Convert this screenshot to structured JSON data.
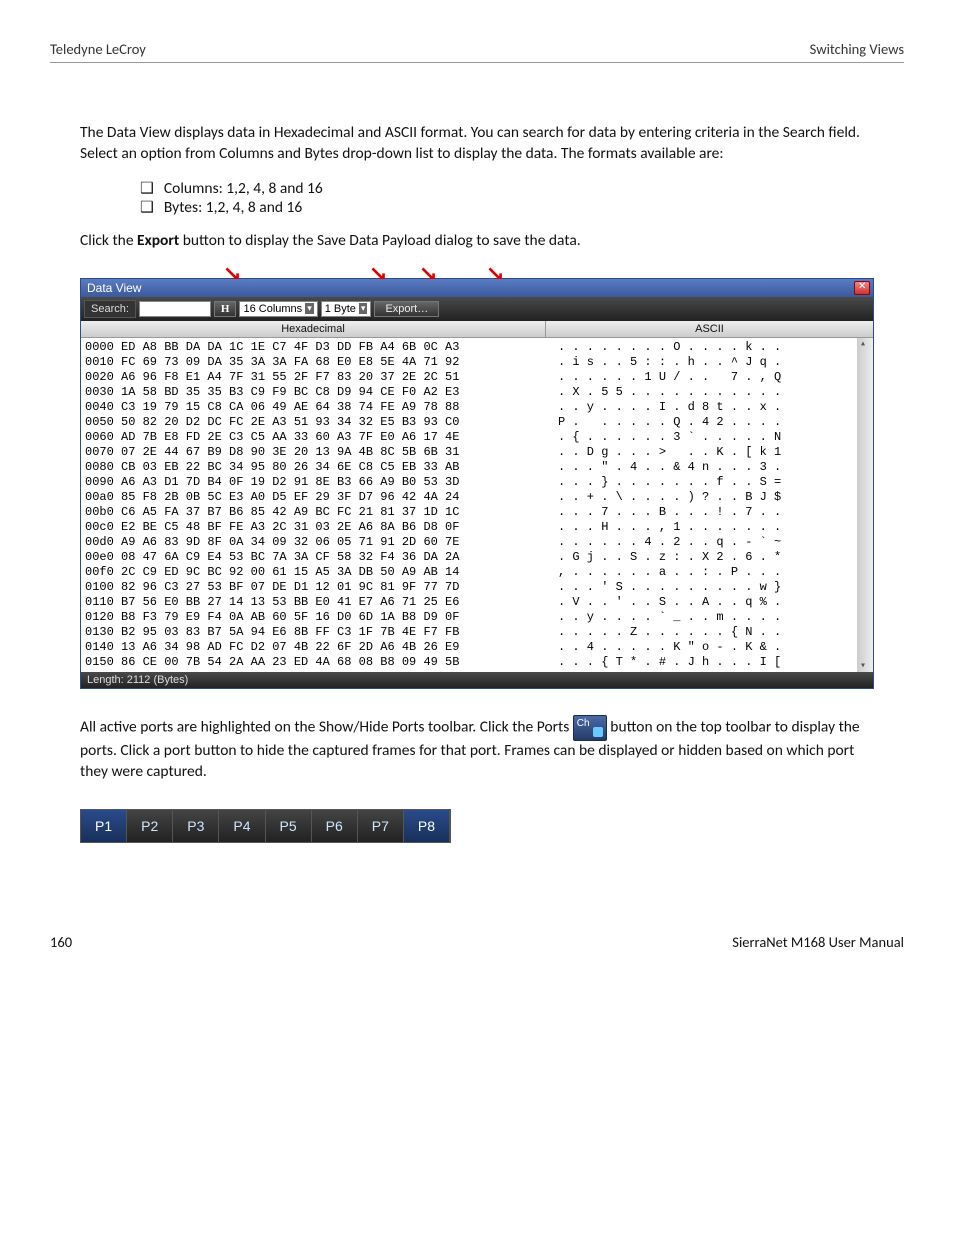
{
  "header": {
    "left": "Teledyne LeCroy",
    "right": "Switching Views"
  },
  "intro": {
    "p1": "The Data View displays data in Hexadecimal and ASCII format. You can search for data by entering criteria in the Search field. Select an option from Columns and Bytes drop-down list to display the data. The formats available are:",
    "li1": "Columns: 1,2, 4, 8 and 16",
    "li2": "Bytes: 1,2, 4, 8 and 16",
    "p2a": "Click the ",
    "p2b": "Export",
    "p2c": " button to display the Save Data Payload dialog to save the data."
  },
  "dv": {
    "title": "Data View",
    "search_label": "Search:",
    "h_button": "H",
    "col_dd": "16 Columns",
    "byte_dd": "1 Byte",
    "export_btn": "Export…",
    "col_hex": "Hexadecimal",
    "col_asc": "ASCII",
    "status": "Length: 2112 (Bytes)",
    "rows": [
      {
        "o": "0000",
        "h": "ED A8 BB DA DA 1C 1E C7 4F D3 DD FB A4 6B 0C A3",
        "a": ". . . . . . . . O . . . . k . ."
      },
      {
        "o": "0010",
        "h": "FC 69 73 09 DA 35 3A 3A FA 68 E0 E8 5E 4A 71 92",
        "a": ". i s . . 5 : : . h . . ^ J q ."
      },
      {
        "o": "0020",
        "h": "A6 96 F8 E1 A4 7F 31 55 2F F7 83 20 37 2E 2C 51",
        "a": ". . . . . . 1 U / . .   7 . , Q"
      },
      {
        "o": "0030",
        "h": "1A 58 BD 35 35 B3 C9 F9 BC C8 D9 94 CE F0 A2 E3",
        "a": ". X . 5 5 . . . . . . . . . . ."
      },
      {
        "o": "0040",
        "h": "C3 19 79 15 C8 CA 06 49 AE 64 38 74 FE A9 78 88",
        "a": ". . y . . . . I . d 8 t . . x ."
      },
      {
        "o": "0050",
        "h": "50 82 20 D2 DC FC 2E A3 51 93 34 32 E5 B3 93 C0",
        "a": "P .   . . . . . Q . 4 2 . . . ."
      },
      {
        "o": "0060",
        "h": "AD 7B E8 FD 2E C3 C5 AA 33 60 A3 7F E0 A6 17 4E",
        "a": ". { . . . . . . 3 ` . . . . . N"
      },
      {
        "o": "0070",
        "h": "07 2E 44 67 B9 D8 90 3E 20 13 9A 4B 8C 5B 6B 31",
        "a": ". . D g . . . >   . . K . [ k 1"
      },
      {
        "o": "0080",
        "h": "CB 03 EB 22 BC 34 95 80 26 34 6E C8 C5 EB 33 AB",
        "a": ". . . \" . 4 . . & 4 n . . . 3 ."
      },
      {
        "o": "0090",
        "h": "A6 A3 D1 7D B4 0F 19 D2 91 8E B3 66 A9 B0 53 3D",
        "a": ". . . } . . . . . . . f . . S ="
      },
      {
        "o": "00a0",
        "h": "85 F8 2B 0B 5C E3 A0 D5 EF 29 3F D7 96 42 4A 24",
        "a": ". . + . \\ . . . . ) ? . . B J $"
      },
      {
        "o": "00b0",
        "h": "C6 A5 FA 37 B7 B6 85 42 A9 BC FC 21 81 37 1D 1C",
        "a": ". . . 7 . . . B . . . ! . 7 . ."
      },
      {
        "o": "00c0",
        "h": "E2 BE C5 48 BF FE A3 2C 31 03 2E A6 8A B6 D8 0F",
        "a": ". . . H . . . , 1 . . . . . . ."
      },
      {
        "o": "00d0",
        "h": "A9 A6 83 9D 8F 0A 34 09 32 06 05 71 91 2D 60 7E",
        "a": ". . . . . . 4 . 2 . . q . - ` ~"
      },
      {
        "o": "00e0",
        "h": "08 47 6A C9 E4 53 BC 7A 3A CF 58 32 F4 36 DA 2A",
        "a": ". G j . . S . z : . X 2 . 6 . *"
      },
      {
        "o": "00f0",
        "h": "2C C9 ED 9C BC 92 00 61 15 A5 3A DB 50 A9 AB 14",
        "a": ", . . . . . . a . . : . P . . ."
      },
      {
        "o": "0100",
        "h": "82 96 C3 27 53 BF 07 DE D1 12 01 9C 81 9F 77 7D",
        "a": ". . . ' S . . . . . . . . . w }"
      },
      {
        "o": "0110",
        "h": "B7 56 E0 BB 27 14 13 53 BB E0 41 E7 A6 71 25 E6",
        "a": ". V . . ' . . S . . A . . q % ."
      },
      {
        "o": "0120",
        "h": "B8 F3 79 E9 F4 0A AB 60 5F 16 D0 6D 1A B8 D9 0F",
        "a": ". . y . . . . ` _ . . m . . . ."
      },
      {
        "o": "0130",
        "h": "B2 95 03 83 B7 5A 94 E6 8B FF C3 1F 7B 4E F7 FB",
        "a": ". . . . . Z . . . . . . { N . ."
      },
      {
        "o": "0140",
        "h": "13 A6 34 98 AD FC D2 07 4B 22 6F 2D A6 4B 26 E9",
        "a": ". . 4 . . . . . K \" o - . K & ."
      },
      {
        "o": "0150",
        "h": "86 CE 00 7B 54 2A AA 23 ED 4A 68 08 B8 09 49 5B",
        "a": ". . . { T * . # . J h . . . I ["
      }
    ]
  },
  "p3a": "All active ports are highlighted on the Show/Hide Ports toolbar. Click the Ports ",
  "p3b": " button on the top toolbar to display the ports. Click a port button to hide the captured frames for that port. Frames can be displayed or hidden based on which port they were captured.",
  "ports": [
    "P1",
    "P2",
    "P3",
    "P4",
    "P5",
    "P6",
    "P7",
    "P8"
  ],
  "footer": {
    "left": "160",
    "right": "SierraNet M168 User Manual"
  }
}
